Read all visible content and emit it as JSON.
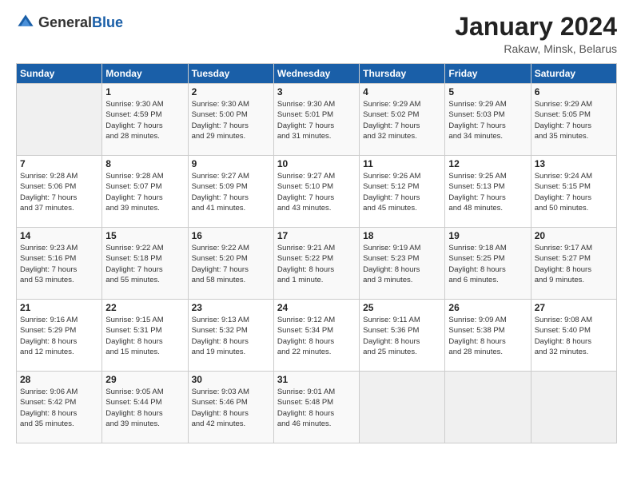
{
  "header": {
    "logo_general": "General",
    "logo_blue": "Blue",
    "month_year": "January 2024",
    "location": "Rakaw, Minsk, Belarus"
  },
  "days_of_week": [
    "Sunday",
    "Monday",
    "Tuesday",
    "Wednesday",
    "Thursday",
    "Friday",
    "Saturday"
  ],
  "weeks": [
    [
      {
        "day": "",
        "info": ""
      },
      {
        "day": "1",
        "info": "Sunrise: 9:30 AM\nSunset: 4:59 PM\nDaylight: 7 hours\nand 28 minutes."
      },
      {
        "day": "2",
        "info": "Sunrise: 9:30 AM\nSunset: 5:00 PM\nDaylight: 7 hours\nand 29 minutes."
      },
      {
        "day": "3",
        "info": "Sunrise: 9:30 AM\nSunset: 5:01 PM\nDaylight: 7 hours\nand 31 minutes."
      },
      {
        "day": "4",
        "info": "Sunrise: 9:29 AM\nSunset: 5:02 PM\nDaylight: 7 hours\nand 32 minutes."
      },
      {
        "day": "5",
        "info": "Sunrise: 9:29 AM\nSunset: 5:03 PM\nDaylight: 7 hours\nand 34 minutes."
      },
      {
        "day": "6",
        "info": "Sunrise: 9:29 AM\nSunset: 5:05 PM\nDaylight: 7 hours\nand 35 minutes."
      }
    ],
    [
      {
        "day": "7",
        "info": "Sunrise: 9:28 AM\nSunset: 5:06 PM\nDaylight: 7 hours\nand 37 minutes."
      },
      {
        "day": "8",
        "info": "Sunrise: 9:28 AM\nSunset: 5:07 PM\nDaylight: 7 hours\nand 39 minutes."
      },
      {
        "day": "9",
        "info": "Sunrise: 9:27 AM\nSunset: 5:09 PM\nDaylight: 7 hours\nand 41 minutes."
      },
      {
        "day": "10",
        "info": "Sunrise: 9:27 AM\nSunset: 5:10 PM\nDaylight: 7 hours\nand 43 minutes."
      },
      {
        "day": "11",
        "info": "Sunrise: 9:26 AM\nSunset: 5:12 PM\nDaylight: 7 hours\nand 45 minutes."
      },
      {
        "day": "12",
        "info": "Sunrise: 9:25 AM\nSunset: 5:13 PM\nDaylight: 7 hours\nand 48 minutes."
      },
      {
        "day": "13",
        "info": "Sunrise: 9:24 AM\nSunset: 5:15 PM\nDaylight: 7 hours\nand 50 minutes."
      }
    ],
    [
      {
        "day": "14",
        "info": "Sunrise: 9:23 AM\nSunset: 5:16 PM\nDaylight: 7 hours\nand 53 minutes."
      },
      {
        "day": "15",
        "info": "Sunrise: 9:22 AM\nSunset: 5:18 PM\nDaylight: 7 hours\nand 55 minutes."
      },
      {
        "day": "16",
        "info": "Sunrise: 9:22 AM\nSunset: 5:20 PM\nDaylight: 7 hours\nand 58 minutes."
      },
      {
        "day": "17",
        "info": "Sunrise: 9:21 AM\nSunset: 5:22 PM\nDaylight: 8 hours\nand 1 minute."
      },
      {
        "day": "18",
        "info": "Sunrise: 9:19 AM\nSunset: 5:23 PM\nDaylight: 8 hours\nand 3 minutes."
      },
      {
        "day": "19",
        "info": "Sunrise: 9:18 AM\nSunset: 5:25 PM\nDaylight: 8 hours\nand 6 minutes."
      },
      {
        "day": "20",
        "info": "Sunrise: 9:17 AM\nSunset: 5:27 PM\nDaylight: 8 hours\nand 9 minutes."
      }
    ],
    [
      {
        "day": "21",
        "info": "Sunrise: 9:16 AM\nSunset: 5:29 PM\nDaylight: 8 hours\nand 12 minutes."
      },
      {
        "day": "22",
        "info": "Sunrise: 9:15 AM\nSunset: 5:31 PM\nDaylight: 8 hours\nand 15 minutes."
      },
      {
        "day": "23",
        "info": "Sunrise: 9:13 AM\nSunset: 5:32 PM\nDaylight: 8 hours\nand 19 minutes."
      },
      {
        "day": "24",
        "info": "Sunrise: 9:12 AM\nSunset: 5:34 PM\nDaylight: 8 hours\nand 22 minutes."
      },
      {
        "day": "25",
        "info": "Sunrise: 9:11 AM\nSunset: 5:36 PM\nDaylight: 8 hours\nand 25 minutes."
      },
      {
        "day": "26",
        "info": "Sunrise: 9:09 AM\nSunset: 5:38 PM\nDaylight: 8 hours\nand 28 minutes."
      },
      {
        "day": "27",
        "info": "Sunrise: 9:08 AM\nSunset: 5:40 PM\nDaylight: 8 hours\nand 32 minutes."
      }
    ],
    [
      {
        "day": "28",
        "info": "Sunrise: 9:06 AM\nSunset: 5:42 PM\nDaylight: 8 hours\nand 35 minutes."
      },
      {
        "day": "29",
        "info": "Sunrise: 9:05 AM\nSunset: 5:44 PM\nDaylight: 8 hours\nand 39 minutes."
      },
      {
        "day": "30",
        "info": "Sunrise: 9:03 AM\nSunset: 5:46 PM\nDaylight: 8 hours\nand 42 minutes."
      },
      {
        "day": "31",
        "info": "Sunrise: 9:01 AM\nSunset: 5:48 PM\nDaylight: 8 hours\nand 46 minutes."
      },
      {
        "day": "",
        "info": ""
      },
      {
        "day": "",
        "info": ""
      },
      {
        "day": "",
        "info": ""
      }
    ]
  ]
}
